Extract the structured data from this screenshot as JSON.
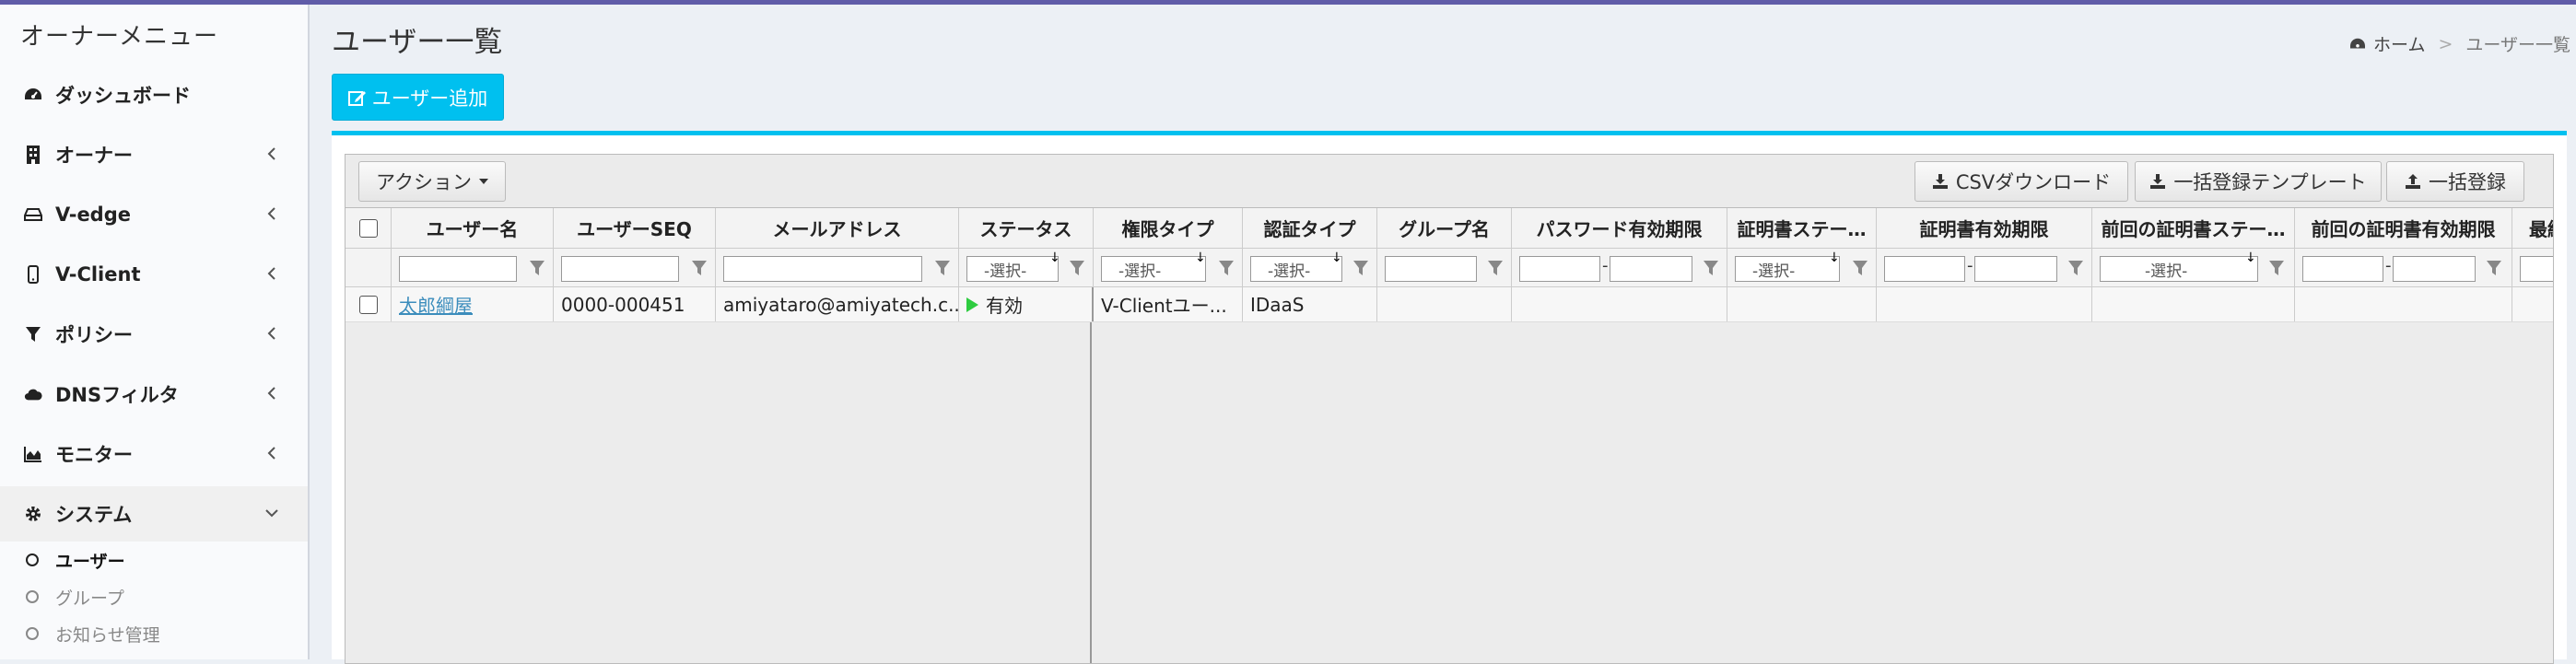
{
  "sidebar": {
    "header": "オーナーメニュー",
    "items": [
      {
        "label": "ダッシュボード",
        "icon": "dashboard-icon"
      },
      {
        "label": "オーナー",
        "icon": "building-icon"
      },
      {
        "label": "V-edge",
        "icon": "hdd-icon"
      },
      {
        "label": "V-Client",
        "icon": "mobile-icon"
      },
      {
        "label": "ポリシー",
        "icon": "filter-icon"
      },
      {
        "label": "DNSフィルタ",
        "icon": "cloud-icon"
      },
      {
        "label": "モニター",
        "icon": "area-chart-icon"
      },
      {
        "label": "システム",
        "icon": "gear-icon"
      }
    ],
    "subitems": [
      {
        "label": "ユーザー"
      },
      {
        "label": "グループ"
      },
      {
        "label": "お知らせ管理"
      }
    ]
  },
  "page": {
    "title": "ユーザー一覧",
    "breadcrumb_home": "ホーム",
    "breadcrumb_sep": ">",
    "breadcrumb_current": "ユーザー一覧",
    "add_button": "ユーザー追加"
  },
  "toolbar": {
    "action": "アクション",
    "csv": "CSVダウンロード",
    "template": "一括登録テンプレート",
    "bulk": "一括登録"
  },
  "columns": [
    "ユーザー名",
    "ユーザーSEQ",
    "メールアドレス",
    "ステータス",
    "権限タイプ",
    "認証タイプ",
    "グループ名",
    "パスワード有効期限",
    "証明書ステー…",
    "証明書有効期限",
    "前回の証明書ステー…",
    "前回の証明書有効期限",
    "最終"
  ],
  "filters": {
    "select_placeholder": "-選択-",
    "range_sep": "-"
  },
  "rows": [
    {
      "username": "太郎綱屋",
      "seq": "0000-000451",
      "email": "amiyataro@amiyatech.c...",
      "status": "有効",
      "role": "V-Clientユー...",
      "auth": "IDaaS"
    }
  ],
  "colors": {
    "accent": "#00c0ef",
    "topbar": "#605ca8",
    "status_active": "#2ecc40"
  }
}
